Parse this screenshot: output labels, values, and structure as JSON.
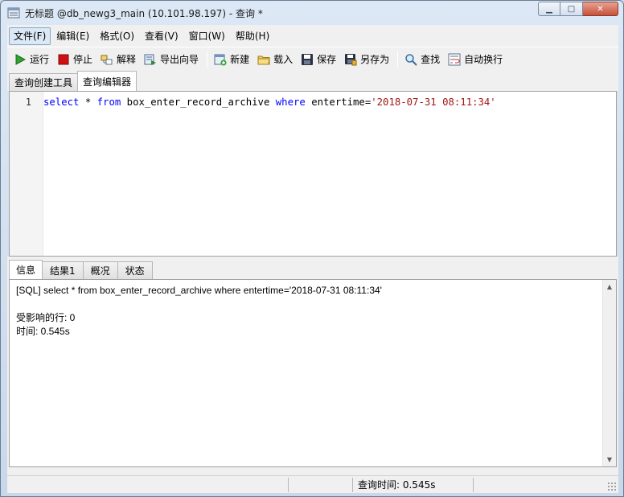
{
  "window": {
    "title": "无标题 @db_newg3_main (10.101.98.197) - 查询 *",
    "min_glyph": "▁",
    "max_glyph": "□",
    "close_glyph": "✕"
  },
  "menu": {
    "items": [
      "文件(F)",
      "编辑(E)",
      "格式(O)",
      "查看(V)",
      "窗口(W)",
      "帮助(H)"
    ]
  },
  "toolbar": {
    "run": "运行",
    "stop": "停止",
    "explain": "解释",
    "export": "导出向导",
    "new": "新建",
    "load": "载入",
    "save": "保存",
    "save_as": "另存为",
    "find": "查找",
    "wrap": "自动换行"
  },
  "top_tabs": [
    "查询创建工具",
    "查询编辑器"
  ],
  "editor": {
    "line_number": "1",
    "sql": {
      "t1": "select",
      "t2": " * ",
      "t3": "from",
      "t4": " box_enter_record_archive ",
      "t5": "where",
      "t6": " entertime=",
      "t7": "'2018-07-31 08:11:34'"
    }
  },
  "bottom_tabs": [
    "信息",
    "结果1",
    "概况",
    "状态"
  ],
  "info": {
    "line1": "[SQL] select * from box_enter_record_archive where entertime='2018-07-31 08:11:34'",
    "line2": "受影响的行: 0",
    "line3": "时间: 0.545s"
  },
  "status": {
    "query_time": "查询时间: 0.545s"
  },
  "colors": {
    "keyword": "#0000ff",
    "string": "#a31515",
    "run_green": "#2fa32f",
    "stop_red": "#d01010"
  }
}
